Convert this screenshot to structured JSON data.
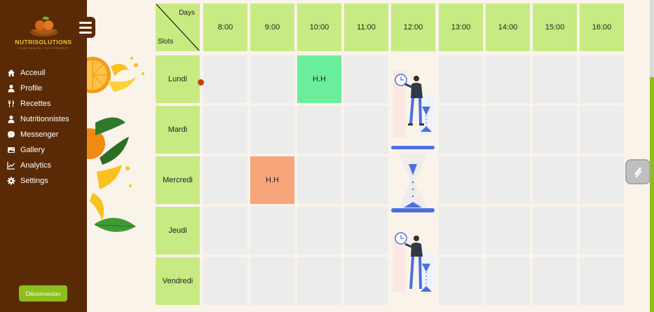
{
  "brand": {
    "name": "NUTRISOLUTIONS",
    "tagline": "YOUR HEALTH, OUR PRIORITY"
  },
  "sidebar": {
    "items": [
      {
        "label": "Acceuil",
        "icon": "home-icon"
      },
      {
        "label": "Profile",
        "icon": "user-icon"
      },
      {
        "label": "Recettes",
        "icon": "utensils-icon"
      },
      {
        "label": "Nutritionnistes",
        "icon": "user-icon"
      },
      {
        "label": "Messenger",
        "icon": "messenger-icon"
      },
      {
        "label": "Gallery",
        "icon": "image-icon"
      },
      {
        "label": "Analytics",
        "icon": "chart-line-icon"
      },
      {
        "label": "Settings",
        "icon": "gear-icon"
      }
    ],
    "logout_label": "Déconnexion"
  },
  "timetable": {
    "corner_days": "Days",
    "corner_slots": "Slots",
    "times": [
      "8:00",
      "9:00",
      "10:00",
      "11:00",
      "12:00",
      "13:00",
      "14:00",
      "15:00",
      "16:00"
    ],
    "days": [
      "Lundi",
      "Mardi",
      "Mercredi",
      "Jeudi",
      "Vendredi"
    ],
    "slot_monday_10": "H.H",
    "slot_wednesday_9": "H.H"
  },
  "colors": {
    "sidebar": "#5a2a06",
    "header_cell": "#c8ea82",
    "empty_cell": "#ececec",
    "slot_green": "#6aee9c",
    "slot_orange": "#f7a67b",
    "logout": "#8dbf1c"
  }
}
